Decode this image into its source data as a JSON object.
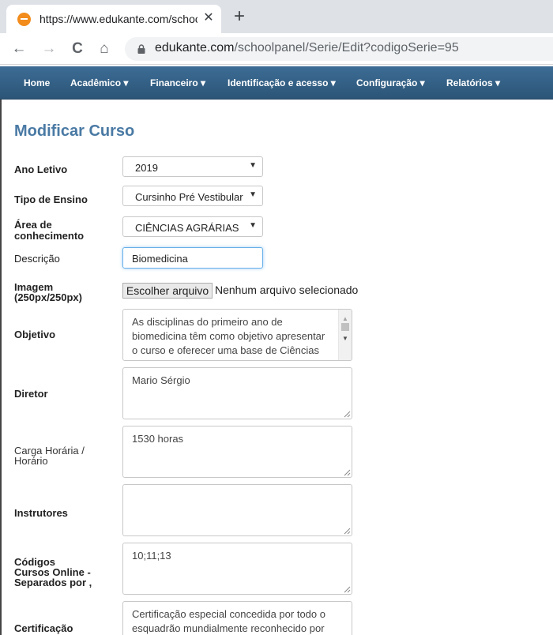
{
  "browser": {
    "tab_title": "https://www.edukante.com/schoo",
    "url_host": "edukante.com",
    "url_path": "/schoolpanel/Serie/Edit?codigoSerie=95",
    "tab_close": "✕",
    "new_tab": "+",
    "back": "←",
    "forward": "→",
    "reload": "C",
    "home": "⌂"
  },
  "nav": {
    "items": [
      "Home",
      "Acadêmico ▾",
      "Financeiro ▾",
      "Identificação e acesso ▾",
      "Configuração ▾",
      "Relatórios ▾"
    ]
  },
  "form": {
    "title": "Modificar Curso",
    "ano_letivo": {
      "label": "Ano Letivo",
      "value": "2019"
    },
    "tipo_ensino": {
      "label": "Tipo de Ensino",
      "value": "Cursinho Pré Vestibular"
    },
    "area": {
      "label_1": "Área de",
      "label_2": "conhecimento",
      "value": "CIÊNCIAS AGRÁRIAS"
    },
    "descricao": {
      "label": "Descrição",
      "value": "Biomedicina"
    },
    "imagem": {
      "label_1": "Imagem",
      "label_2": "(250px/250px)",
      "button": "Escolher arquivo",
      "status": "Nenhum arquivo selecionado"
    },
    "objetivo": {
      "label": "Objetivo",
      "value": "As disciplinas do primeiro ano de biomedicina têm como objetivo apresentar o curso e oferecer uma base de Ciências Biológicas, Exatas e da Saúde para o aluno."
    },
    "diretor": {
      "label": "Diretor",
      "value": "Mario Sérgio"
    },
    "carga": {
      "label_1": "Carga Horária /",
      "label_2": "Horário",
      "value": "1530 horas"
    },
    "instrutores": {
      "label": "Instrutores",
      "value": ""
    },
    "codigos": {
      "label_1": "Códigos",
      "label_2": "Cursos Online -",
      "label_3": "Separados por ,",
      "value": "10;11;13"
    },
    "certificacao": {
      "label": "Certificação",
      "value": "Certificação especial concedida por todo o esquadrão mundialmente reconhecido por seus"
    }
  },
  "colors": {
    "navbar": "#2f5a7e",
    "title": "#4a7aa4",
    "focus": "#66afe9"
  }
}
